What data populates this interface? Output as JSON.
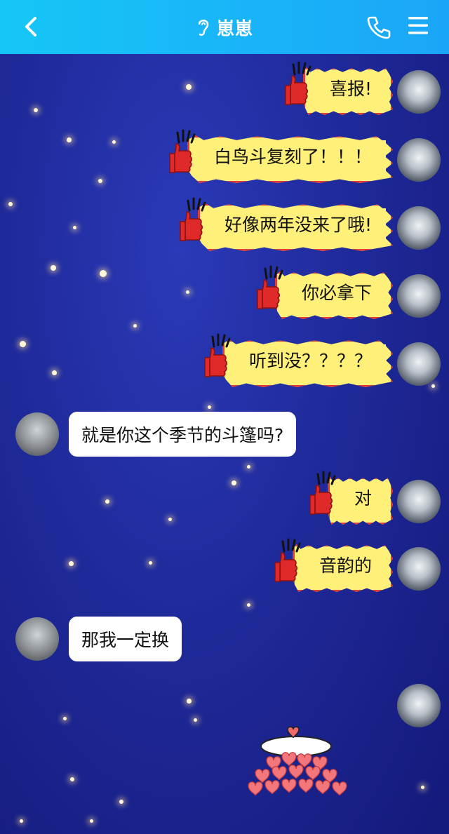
{
  "header": {
    "title": "崽崽",
    "back_icon": "chevron-left-icon",
    "ear_icon": "ear-icon",
    "call_icon": "phone-icon",
    "menu_icon": "menu-icon"
  },
  "messages": [
    {
      "side": "right",
      "kind": "sticker",
      "text": "喜报!"
    },
    {
      "side": "right",
      "kind": "sticker",
      "text": "白鸟斗复刻了！！！"
    },
    {
      "side": "right",
      "kind": "sticker",
      "text": "好像两年没来了哦!"
    },
    {
      "side": "right",
      "kind": "sticker",
      "text": "你必拿下"
    },
    {
      "side": "right",
      "kind": "sticker",
      "text": "听到没？？？？"
    },
    {
      "side": "left",
      "kind": "text",
      "text": "就是你这个季节的斗篷吗?"
    },
    {
      "side": "right",
      "kind": "sticker",
      "text": "对"
    },
    {
      "side": "right",
      "kind": "sticker",
      "text": "音韵的"
    },
    {
      "side": "left",
      "kind": "text",
      "text": "那我一定换"
    },
    {
      "side": "right",
      "kind": "image",
      "text": "hearts-pile-sticker"
    }
  ],
  "colors": {
    "header": "#19b4f8",
    "background": "#1f2a9a",
    "sticker_fill": "#fff07a",
    "sticker_border": "#e23a3a"
  }
}
